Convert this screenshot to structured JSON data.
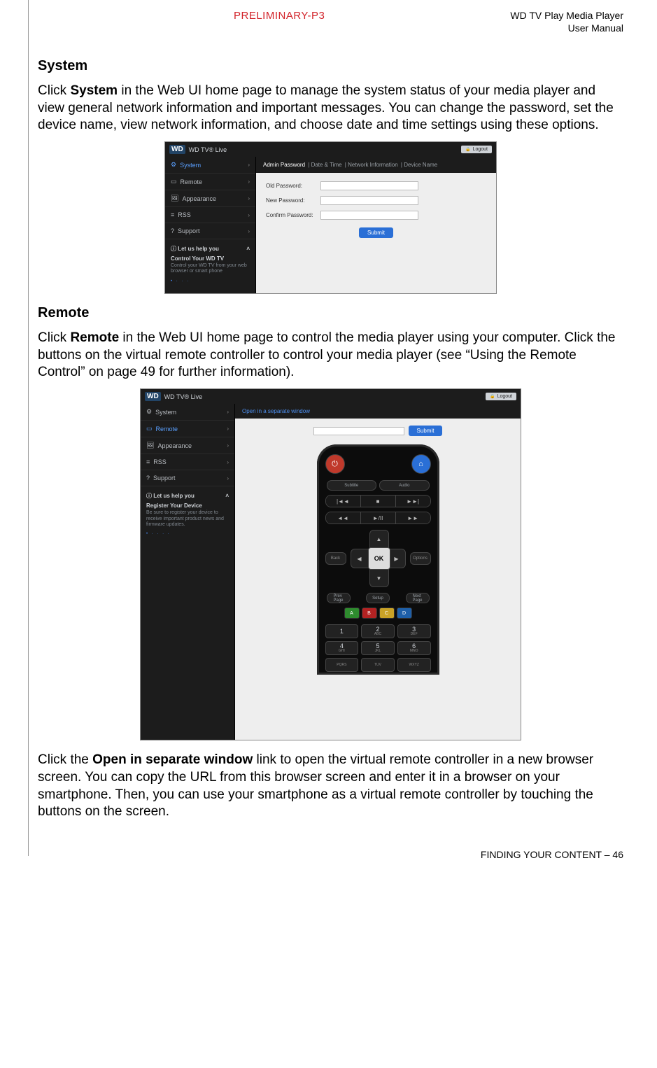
{
  "header": {
    "preliminary": "PRELIMINARY-P3",
    "product": "WD TV Play Media Player",
    "doc": "User Manual"
  },
  "section1": {
    "title": "System",
    "body_pre": "Click ",
    "body_bold": "System",
    "body_post": " in the Web UI home page to manage the system status of your media player and view general network information and important messages. You can change the password, set the device name, view network information, and choose date and time settings using these options."
  },
  "shot1": {
    "brand_tag": "WD",
    "brand_text": "WD TV® Live",
    "logout": "Logout",
    "sidebar": [
      {
        "icon": "⚙",
        "label": "System",
        "active": true
      },
      {
        "icon": "▭",
        "label": "Remote",
        "active": false
      },
      {
        "icon": "🖼",
        "label": "Appearance",
        "active": false
      },
      {
        "icon": "≡",
        "label": "RSS",
        "active": false
      },
      {
        "icon": "?",
        "label": "Support",
        "active": false
      }
    ],
    "help": {
      "title": "ⓘ  Let us help you",
      "sub": "Control Your WD TV",
      "desc": "Control your WD TV from your web browser or smart phone"
    },
    "tabs": [
      "Admin Password",
      "Date & Time",
      "Network Information",
      "Device Name"
    ],
    "tabs_selected": 0,
    "fields": [
      "Old Password:",
      "New Password:",
      "Confirm Password:"
    ],
    "submit": "Submit"
  },
  "section2": {
    "title": "Remote",
    "body_pre": "Click ",
    "body_bold": "Remote",
    "body_post": " in the Web UI home page to control the media player using your computer. Click the buttons on the virtual remote controller to control your media player (see “Using the Remote Control” on page 49 for further information)."
  },
  "shot2": {
    "brand_tag": "WD",
    "brand_text": "WD TV® Live",
    "logout": "Logout",
    "sidebar": [
      {
        "icon": "⚙",
        "label": "System",
        "active": false
      },
      {
        "icon": "▭",
        "label": "Remote",
        "active": true
      },
      {
        "icon": "🖼",
        "label": "Appearance",
        "active": false
      },
      {
        "icon": "≡",
        "label": "RSS",
        "active": false
      },
      {
        "icon": "?",
        "label": "Support",
        "active": false
      }
    ],
    "help": {
      "title": "ⓘ  Let us help you",
      "sub": "Register Your Device",
      "desc": "Be sure to register your device to receive important product news and firmware updates."
    },
    "open_link": "Open in a separate window",
    "submit": "Submit",
    "remote": {
      "subtitle": "Subtitle",
      "audio": "Audio",
      "back": "Back",
      "options": "Options",
      "prev_page": "Prev\nPage",
      "next_page": "Next\nPage",
      "setup": "Setup",
      "ok": "OK",
      "colors": [
        "A",
        "B",
        "C",
        "D"
      ],
      "nums": [
        {
          "n": "1",
          "s": ""
        },
        {
          "n": "2",
          "s": "ABC"
        },
        {
          "n": "3",
          "s": "DEF"
        },
        {
          "n": "4",
          "s": "GHI"
        },
        {
          "n": "5",
          "s": "JKL"
        },
        {
          "n": "6",
          "s": "MNO"
        },
        {
          "n": "",
          "s": "PQRS"
        },
        {
          "n": "",
          "s": "TUV"
        },
        {
          "n": "",
          "s": "WXYZ"
        }
      ]
    }
  },
  "section3": {
    "pre": "Click the ",
    "bold": "Open in separate window",
    "post": " link to open the virtual remote controller in a new browser screen. You can copy the URL from this browser screen and enter it in a browser on your smartphone. Then, you can use your smartphone as a virtual remote controller by touching the buttons on the screen."
  },
  "footer": {
    "text": "FINDING YOUR CONTENT – 46"
  }
}
